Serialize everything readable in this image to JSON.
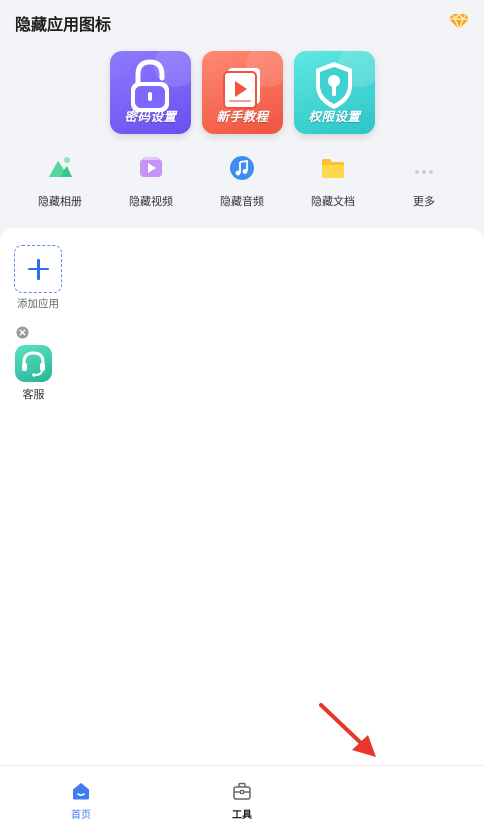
{
  "header": {
    "title": "隐藏应用图标",
    "vip_icon": "vip-diamond-icon"
  },
  "feature_cards": [
    {
      "label": "密码设置",
      "icon": "padlock-icon",
      "color": "#6f55f5"
    },
    {
      "label": "新手教程",
      "icon": "video-book-icon",
      "color": "#f5614a"
    },
    {
      "label": "权限设置",
      "icon": "shield-key-icon",
      "color": "#35cdd0"
    }
  ],
  "quick_actions": [
    {
      "label": "隐藏相册",
      "icon": "photo-mountain-icon",
      "color": "#36c48a"
    },
    {
      "label": "隐藏视频",
      "icon": "video-play-icon",
      "color": "#b57cf2"
    },
    {
      "label": "隐藏音频",
      "icon": "music-note-icon",
      "color": "#3f8cf3"
    },
    {
      "label": "隐藏文档",
      "icon": "folder-icon",
      "color": "#ffcf33"
    },
    {
      "label": "更多",
      "icon": "more-dots-icon",
      "color": "#c8c8c8"
    }
  ],
  "apps": {
    "add_label": "添加应用",
    "items": [
      {
        "label": "客服",
        "icon": "headset-icon",
        "color": "#34c3a0"
      }
    ]
  },
  "tabbar": {
    "tabs": [
      {
        "label": "首页",
        "icon": "home-icon",
        "active": true,
        "color": "#3d7bf5"
      },
      {
        "label": "工具",
        "icon": "toolbox-icon",
        "active": false
      }
    ]
  },
  "annotation": {
    "icon": "red-arrow-icon",
    "color": "#e8362a"
  }
}
